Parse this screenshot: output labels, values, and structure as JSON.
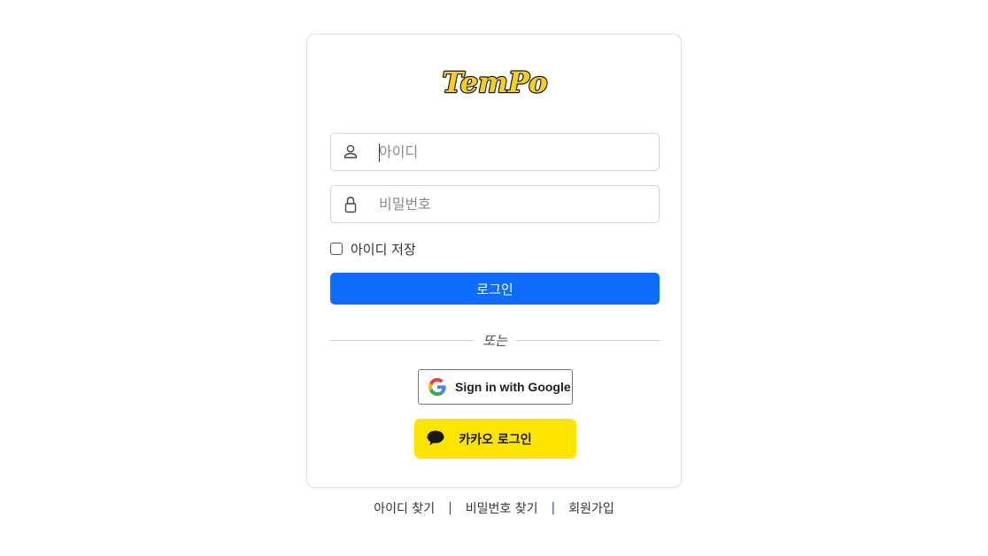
{
  "logo": {
    "text": "TemPo",
    "fill_color": "#f7cf1f",
    "outline_color": "#1a1a1a"
  },
  "form": {
    "id_field": {
      "placeholder": "아이디",
      "icon": "user-icon"
    },
    "password_field": {
      "placeholder": "비밀번호",
      "icon": "lock-icon"
    },
    "remember_label": "아이디 저장",
    "login_label": "로그인",
    "divider_text": "또는"
  },
  "social": {
    "google_label": "Sign in with Google",
    "kakao_label": "카카오 로그인"
  },
  "footer": {
    "find_id": "아이디 찾기",
    "separator": "|",
    "find_password": "비밀번호 찾기",
    "signup": "회원가입"
  },
  "colors": {
    "primary": "#0d6efd",
    "kakao": "#fee500",
    "border": "#cfd4da"
  }
}
